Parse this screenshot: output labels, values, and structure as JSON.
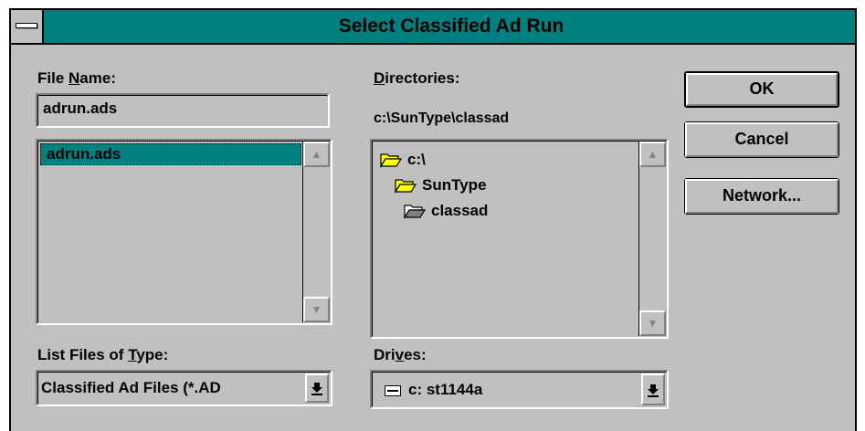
{
  "window": {
    "title": "Select Classified Ad Run"
  },
  "file_name": {
    "label_pre": "File ",
    "label_accel": "N",
    "label_post": "ame:",
    "value": "adrun.ads",
    "list": [
      "adrun.ads"
    ]
  },
  "directories": {
    "label_accel": "D",
    "label_post": "irectories:",
    "current_path": "c:\\SunType\\classad",
    "tree": [
      {
        "label": "c:\\",
        "icon": "open-folder-icon"
      },
      {
        "label": "SunType",
        "icon": "open-folder-icon"
      },
      {
        "label": "classad",
        "icon": "open-folder-selected-icon"
      }
    ]
  },
  "file_type": {
    "label_pre": "List Files of ",
    "label_accel": "T",
    "label_post": "ype:",
    "selected": "Classified Ad Files (*.AD"
  },
  "drives": {
    "label_pre": "Dri",
    "label_accel": "v",
    "label_post": "es:",
    "selected": "c: st1144a",
    "icon": "hard-drive-icon"
  },
  "buttons": {
    "ok": "OK",
    "cancel": "Cancel",
    "network": "Network..."
  },
  "colors": {
    "titlebar": "#008080",
    "face": "#c0c0c0",
    "selection": "#008080"
  }
}
